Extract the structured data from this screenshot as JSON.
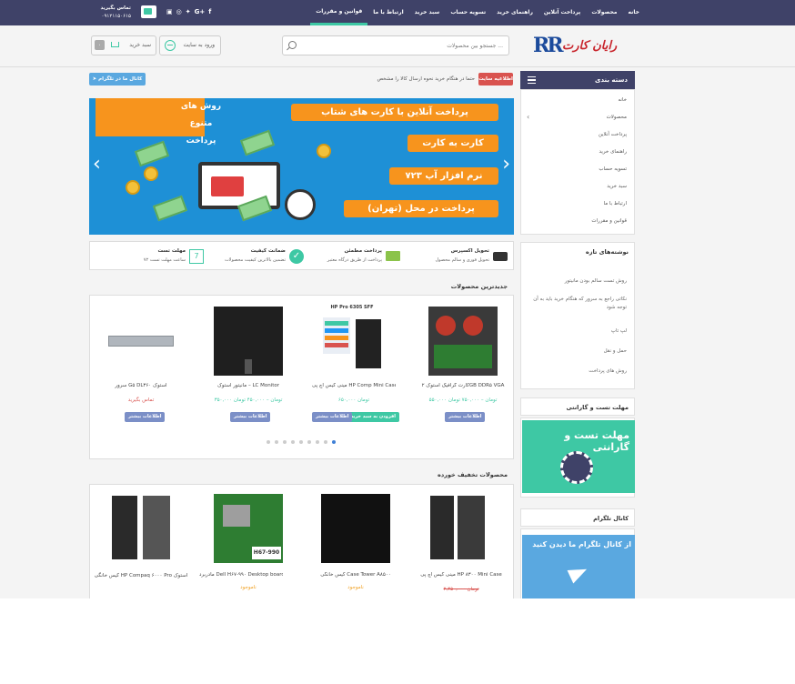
{
  "topbar": {
    "nav": [
      "خانه",
      "محصولات",
      "پرداخت آنلاین",
      "راهنمای خرید",
      "تسویه حساب",
      "سبد خرید",
      "ارتباط با ما",
      "قوانین و مقررات"
    ],
    "active_index": 7,
    "contact_label": "تماس بگیرید",
    "contact_phone": "۰۹۱۲۱۱۵۰۶۱۵"
  },
  "header": {
    "logo_mark": "RR",
    "logo_text": "رایان کارت",
    "search_placeholder": "جستجو بین محصولات ...",
    "login_label": "ورود به سایت",
    "cart_label": "سبد خرید",
    "cart_count": "۰"
  },
  "notice": {
    "badge": "اطلاعیه سایت",
    "text": "حتما در هنگام خرید نحوه ارسال کالا را مشخص",
    "telegram_label": "کانال ما در تلگرام"
  },
  "sidebar": {
    "categories_title": "دسته بندی",
    "categories": [
      "خانه",
      "محصولات",
      "پرداخت آنلاین",
      "راهنمای خرید",
      "تسویه حساب",
      "سبد خرید",
      "ارتباط با ما",
      "قوانین و مقررات"
    ],
    "posts_title": "نوشته‌های تازه",
    "posts": [
      "روش تست سالم بودن مانیتور",
      "نکاتی راجع به سرور که هنگام خرید باید به آن توجه شود",
      "لپ تاپ",
      "حمل و نقل",
      "روش های پرداخت"
    ],
    "warranty_title": "مهلت تست و گارانتی",
    "warranty_image_text": "مهلت تست و گارانتی",
    "telegram_title": "کانال تلگرام",
    "telegram_image_text": "از کانال تلگرام ما دیدن کنید"
  },
  "slider": {
    "tag_text": "روش های متنوع پرداخت",
    "lines": [
      "پرداخت آنلاین با کارت های شتاب",
      "کارت به کارت",
      "نرم افزار آپ ۷۲۳",
      "پرداخت در محل (تهران)"
    ],
    "prev_icon": "chevron-left-icon",
    "next_icon": "chevron-right-icon"
  },
  "features": [
    {
      "title": "تحویل اکسپرس",
      "subtitle": "تحویل فوری و سالم محصول",
      "icon": "truck-icon"
    },
    {
      "title": "پرداخت مطمئن",
      "subtitle": "پرداخت از طریق درگاه معتبر",
      "icon": "card-icon"
    },
    {
      "title": "ضمانت کیفیت",
      "subtitle": "تضمین بالاترین کیفیت محصولات",
      "icon": "check-icon"
    },
    {
      "title": "مهلت تست",
      "subtitle": "۷۲ ساعت مهلت تست",
      "icon": "calendar-icon"
    }
  ],
  "newest": {
    "title": "جدیدترین محصولات",
    "products": [
      {
        "name": "کارت گرافیک استوک ۲GB DDR۵ VGA",
        "price": "۵۵۰,۰۰۰ تومان – ۷۵۰,۰۰۰ تومان",
        "button": "اطلاعات بیشتر",
        "image_label": ""
      },
      {
        "name": "مینی کیس اچ پی HP Comp Mini Case",
        "price": "۶۵۰,۰۰۰ تومان",
        "button": "افزودن به سبد خرید",
        "image_label": "HP Pro 6305 SFF"
      },
      {
        "name": "مانیتور استوک – LC Monitor",
        "price": "۳۵۰,۰۰۰ تومان – ۴۵۰,۰۰۰ تومان",
        "button": "اطلاعات بیشتر",
        "image_label": ""
      },
      {
        "name": "سرور G۵ DL۳۶۰ استوک",
        "price": "تماس بگیرید",
        "button": "اطلاعات بیشتر",
        "image_label": ""
      }
    ],
    "dots": 9,
    "active_dot": 0
  },
  "discount": {
    "title": "محصولات تخفیف خورده",
    "products": [
      {
        "name": "مینی کیس اچ پی HP ۸۳۰۰ Mini Case",
        "price": "۲,۴۵۰,۰۰۰ تومان"
      },
      {
        "name": "کیس خانگی Case Tower A۸۵۰۰",
        "price": "ناموجود"
      },
      {
        "name": "مادربرد Dell H۶۷-۹۹۰ Desktop board",
        "price": "ناموجود"
      },
      {
        "name": "کیس خانگی HP Compaq ۶۰۰۰ Pro استوک",
        "price": ""
      }
    ]
  },
  "colors": {
    "nav_bg": "#3f4268",
    "accent": "#3ec8a4",
    "badge_red": "#d9534f",
    "slider_blue": "#1e90d6",
    "slider_orange": "#f7941d"
  }
}
